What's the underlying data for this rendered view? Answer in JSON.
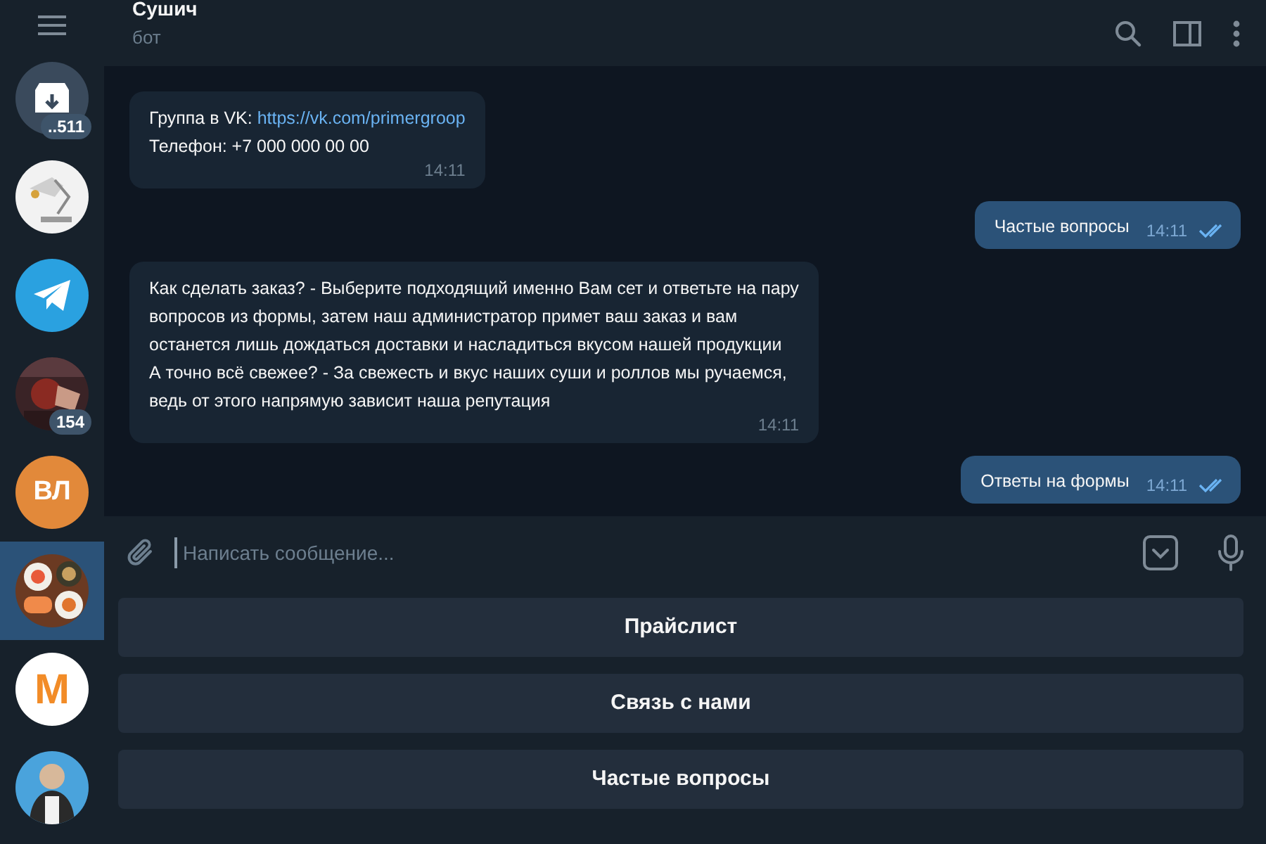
{
  "sidebar": {
    "items": [
      {
        "kind": "archive",
        "badge": "..511",
        "selected": false
      },
      {
        "kind": "picture",
        "selected": false
      },
      {
        "kind": "plane",
        "selected": false
      },
      {
        "kind": "picture",
        "badge": "154",
        "selected": false
      },
      {
        "kind": "initials",
        "initials": "ВЛ",
        "color": "#e2893a",
        "selected": false
      },
      {
        "kind": "picture",
        "selected": true
      },
      {
        "kind": "letter",
        "initials": "M",
        "color": "#f28c28",
        "selected": false
      },
      {
        "kind": "picture",
        "selected": false
      }
    ]
  },
  "header": {
    "title": "Сушич",
    "subtitle": "бот"
  },
  "messages": [
    {
      "kind": "incoming",
      "lines": [
        {
          "text": "Группа в VK: ",
          "link": "https://vk.com/primergroop"
        },
        {
          "text": "Телефон: +7 000 000 00 00"
        }
      ],
      "time": "14:11"
    },
    {
      "kind": "outgoing",
      "lines": [
        {
          "text": "Частые вопросы"
        }
      ],
      "time": "14:11",
      "read": true
    },
    {
      "kind": "incoming",
      "lines": [
        {
          "text": "Как сделать заказ? - Выберите подходящий именно Вам сет и ответьте на пару вопросов из формы, затем наш администратор примет ваш заказ и вам останется лишь дождаться доставки и насладиться вкусом нашей продукции"
        },
        {
          "text": "А точно всё свежее? - За свежесть и вкус наших суши и роллов мы ручаемся, ведь от этого напрямую зависит наша репутация"
        }
      ],
      "time": "14:11"
    },
    {
      "kind": "outgoing",
      "lines": [
        {
          "text": "Ответы на формы"
        }
      ],
      "time": "14:11",
      "read": true
    }
  ],
  "composer": {
    "placeholder": "Написать сообщение..."
  },
  "keyboard": [
    "Прайслист",
    "Связь с нами",
    "Частые вопросы"
  ]
}
